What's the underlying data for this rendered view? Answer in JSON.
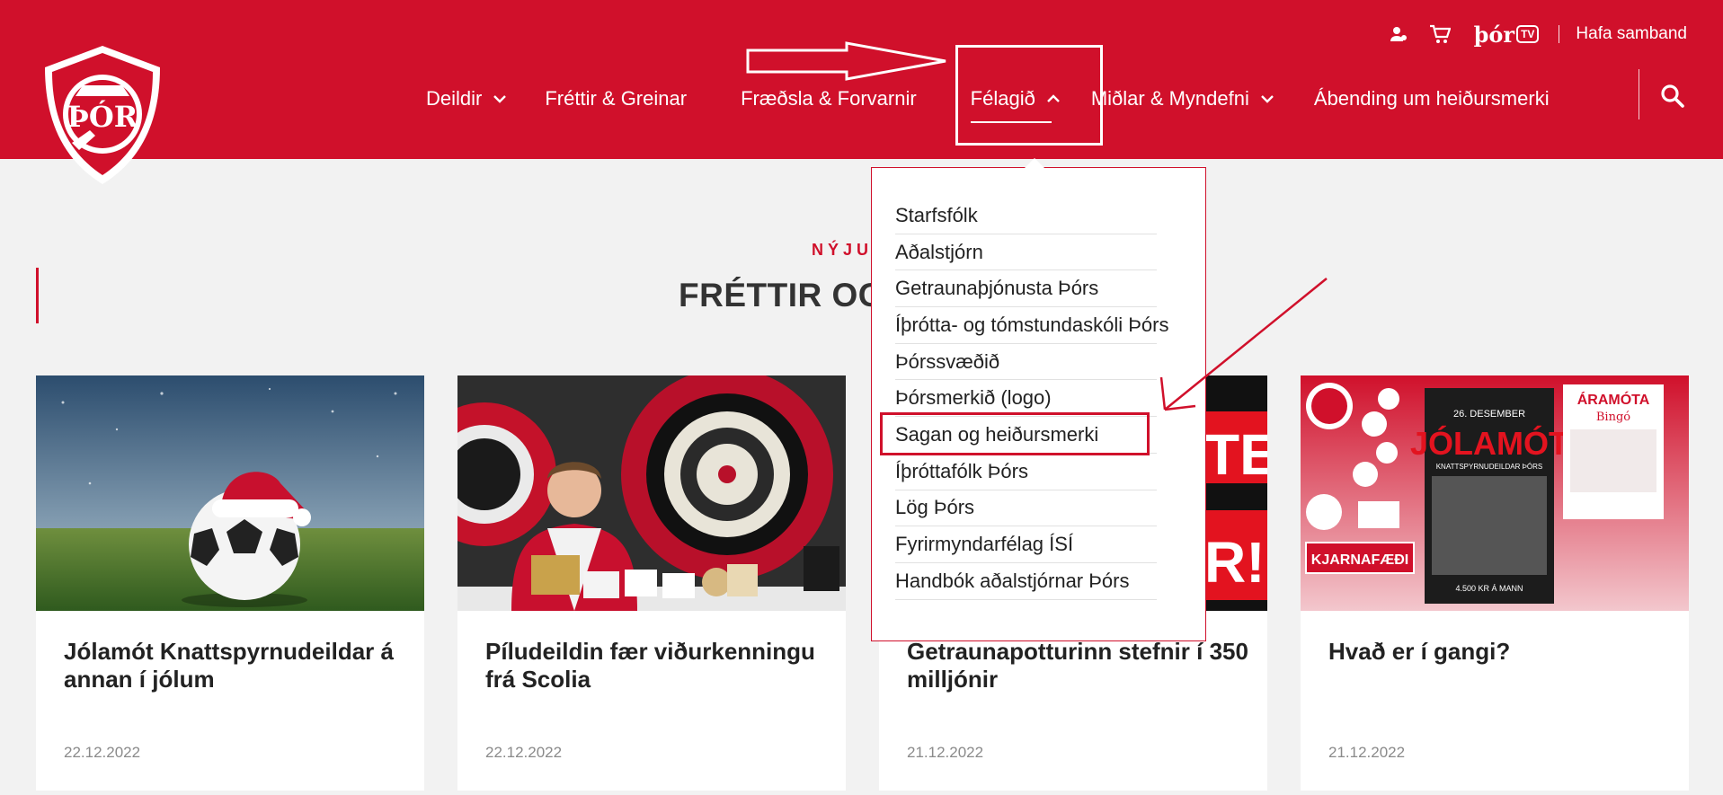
{
  "header": {
    "brand_color": "#d0102b",
    "logo_text": "ÞÓR",
    "utility": {
      "account_icon": "person-icon",
      "cart_icon": "cart-icon",
      "tv_brand": "þór",
      "tv_label": "TV",
      "contact_label": "Hafa samband"
    },
    "nav": [
      {
        "label": "Deildir"
      },
      {
        "label": "Fréttir & Greinar"
      },
      {
        "label": "Fræðsla & Forvarnir"
      },
      {
        "label": "Félagið"
      },
      {
        "label": "Miðlar & Myndefni"
      },
      {
        "label": "Ábending um heiðursmerki"
      }
    ],
    "search_icon": "search-icon"
  },
  "section": {
    "kicker": "NÝJUS",
    "title": "FRÉTTIR OG T"
  },
  "dropdown": {
    "items": [
      {
        "label": "Starfsfólk"
      },
      {
        "label": "Aðalstjórn"
      },
      {
        "label": "Getraunaþjónusta Þórs"
      },
      {
        "label": "Íþrótta- og tómstundaskóli Þórs"
      },
      {
        "label": "Þórssvæðið"
      },
      {
        "label": "Þórsmerkið (logo)"
      },
      {
        "label": "Sagan og heiðursmerki"
      },
      {
        "label": "Íþróttafólk Þórs"
      },
      {
        "label": "Lög Þórs"
      },
      {
        "label": "Fyrirmyndarfélag ÍSÍ"
      },
      {
        "label": "Handbók aðalstjórnar Þórs"
      }
    ]
  },
  "cards": [
    {
      "title": "Jólamót Knattspyrnudeildar á annan í jólum",
      "date": "22.12.2022"
    },
    {
      "title": "Píludeildin fær viðurkenningu frá Scolia",
      "date": "22.12.2022"
    },
    {
      "title": "Getraunapotturinn stefnir í 350 milljónir",
      "date": "21.12.2022"
    },
    {
      "title": "Hvað er í gangi?",
      "date": "21.12.2022"
    }
  ],
  "card_images": {
    "card3_big_text": "TE",
    "card3_big_text2": "R!",
    "card4_poster_date": "26. DESEMBER",
    "card4_poster_title": "JÓLAMÓT",
    "card4_poster_sub": "KNATTSPYRNUDEILDAR ÞÓRS",
    "card4_poster_price": "4.500 KR Á MANN",
    "card4_right_title": "ÁRAMÓTA",
    "card4_right_sub": "Bingó",
    "card4_sponsor": "KJARNAFÆÐI"
  }
}
